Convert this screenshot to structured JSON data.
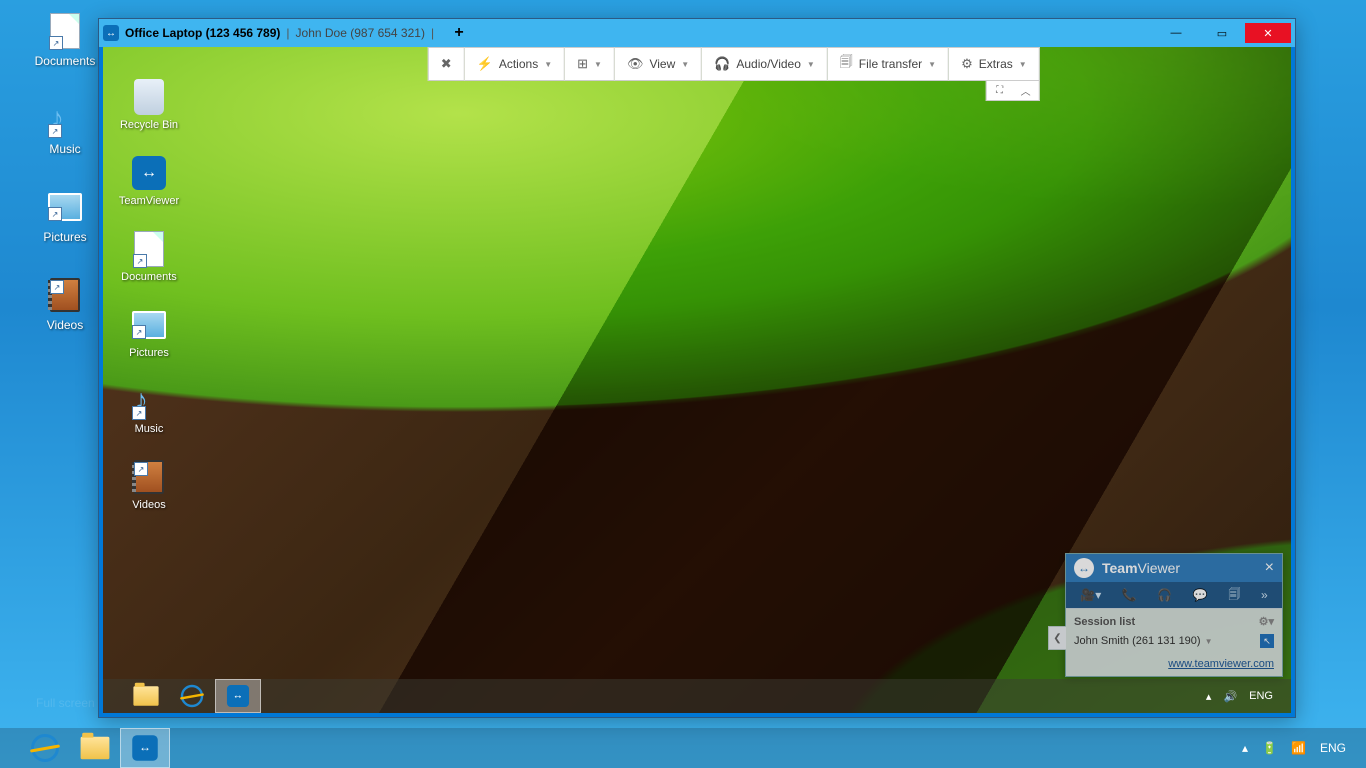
{
  "local": {
    "icons": [
      {
        "label": "Documents",
        "type": "doc"
      },
      {
        "label": "Music",
        "type": "music"
      },
      {
        "label": "Pictures",
        "type": "pic"
      },
      {
        "label": "Videos",
        "type": "vid"
      }
    ],
    "taskbar": {
      "lang": "ENG"
    }
  },
  "tv": {
    "tab_active": "Office Laptop (123 456 789)",
    "tab_second": "John Doe (987 654 321)",
    "toolbar": {
      "actions": "Actions",
      "view": "View",
      "audiovideo": "Audio/Video",
      "filetransfer": "File transfer",
      "extras": "Extras"
    }
  },
  "remote": {
    "icons": [
      {
        "label": "Recycle Bin",
        "type": "bin"
      },
      {
        "label": "TeamViewer",
        "type": "tv"
      },
      {
        "label": "Documents",
        "type": "doc"
      },
      {
        "label": "Pictures",
        "type": "pic"
      },
      {
        "label": "Music",
        "type": "music"
      },
      {
        "label": "Videos",
        "type": "vid"
      }
    ],
    "taskbar": {
      "lang": "ENG"
    },
    "panel": {
      "brand_a": "Team",
      "brand_b": "Viewer",
      "section": "Session list",
      "session": "John Smith (261 131 190)",
      "url": "www.teamviewer.com"
    }
  },
  "hint": "Full screen"
}
